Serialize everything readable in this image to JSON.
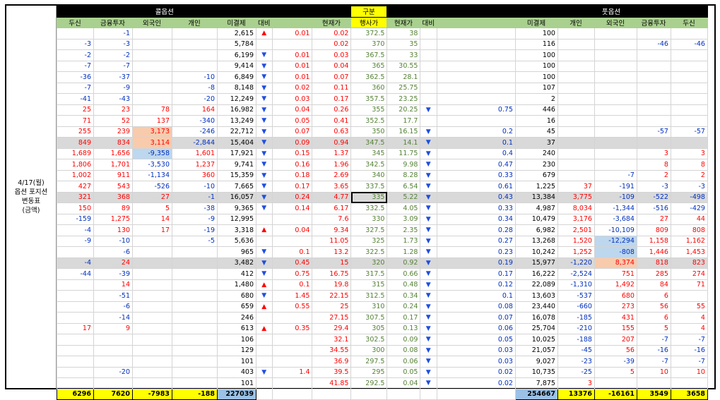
{
  "row_label": [
    "4/17(월)",
    "옵션 포지션",
    "변동표",
    "(금액)"
  ],
  "top": {
    "call": "콜옵션",
    "center": "구분",
    "put": "풋옵션"
  },
  "headers": [
    "두신",
    "금융투자",
    "외국인",
    "개인",
    "미결제",
    "대비",
    "",
    "현재가",
    "행사가",
    "현재가",
    "대비",
    "",
    "미결제",
    "개인",
    "외국인",
    "금융투자",
    "두신"
  ],
  "colors": {
    "header_green": "#a9d08e",
    "total_yellow": "#ffff00",
    "highlight_orange": "#f8cbad",
    "highlight_blue": "#bdd7ee",
    "row_gray": "#d9d9d9"
  },
  "rows": [
    {
      "c": [
        "",
        "-1",
        "",
        "",
        "2,615",
        "▲",
        "0.01",
        "0.02",
        "372.5",
        "38",
        "",
        "",
        "100",
        "",
        "",
        "",
        ""
      ]
    },
    {
      "c": [
        "-3",
        "-3",
        "",
        "",
        "5,784",
        "",
        "",
        "0.02",
        "370",
        "35",
        "",
        "",
        "116",
        "",
        "",
        "-46",
        "-46"
      ]
    },
    {
      "c": [
        "-2",
        "-2",
        "",
        "",
        "6,199",
        "▼",
        "0.01",
        "0.03",
        "367.5",
        "33",
        "",
        "",
        "100",
        "",
        "",
        "",
        ""
      ]
    },
    {
      "c": [
        "-7",
        "-7",
        "",
        "",
        "9,414",
        "▼",
        "0.01",
        "0.04",
        "365",
        "30.55",
        "",
        "",
        "100",
        "",
        "",
        "",
        ""
      ]
    },
    {
      "c": [
        "-36",
        "-37",
        "",
        "-10",
        "6,849",
        "▼",
        "0.01",
        "0.07",
        "362.5",
        "28.1",
        "",
        "",
        "100",
        "",
        "",
        "",
        ""
      ]
    },
    {
      "c": [
        "-7",
        "-9",
        "",
        "-8",
        "8,148",
        "▼",
        "0.02",
        "0.11",
        "360",
        "25.75",
        "",
        "",
        "107",
        "",
        "",
        "",
        ""
      ]
    },
    {
      "c": [
        "-41",
        "-43",
        "",
        "-20",
        "12,249",
        "▼",
        "0.03",
        "0.17",
        "357.5",
        "23.25",
        "",
        "",
        "2",
        "",
        "",
        "",
        ""
      ]
    },
    {
      "c": [
        "25",
        "23",
        "78",
        "164",
        "16,982",
        "▼",
        "0.04",
        "0.26",
        "355",
        "20.25",
        "▼",
        "0.75",
        "446",
        "",
        "",
        "",
        ""
      ]
    },
    {
      "c": [
        "71",
        "52",
        "137",
        "-340",
        "13,249",
        "▼",
        "0.05",
        "0.41",
        "352.5",
        "17.7",
        "",
        "",
        "16",
        "",
        "",
        "",
        ""
      ]
    },
    {
      "c": [
        "255",
        "239",
        "3,173",
        "-246",
        "22,712",
        "▼",
        "0.07",
        "0.63",
        "350",
        "16.15",
        "▼",
        "0.2",
        "45",
        "",
        "",
        "-57",
        "-57"
      ]
    },
    {
      "c": [
        "849",
        "834",
        "3,114",
        "-2,844",
        "15,404",
        "▼",
        "0.09",
        "0.94",
        "347.5",
        "14.1",
        "▼",
        "0.1",
        "37",
        "",
        "",
        "",
        ""
      ]
    },
    {
      "c": [
        "1,689",
        "1,656",
        "-9,358",
        "1,601",
        "17,921",
        "▼",
        "0.15",
        "1.37",
        "345",
        "11.75",
        "▼",
        "0.4",
        "240",
        "",
        "",
        "3",
        "3"
      ]
    },
    {
      "c": [
        "1,806",
        "1,701",
        "-3,530",
        "1,237",
        "9,741",
        "▼",
        "0.16",
        "1.96",
        "342.5",
        "9.98",
        "▼",
        "0.47",
        "230",
        "",
        "",
        "8",
        "8"
      ]
    },
    {
      "c": [
        "1,002",
        "911",
        "-1,134",
        "360",
        "15,359",
        "▼",
        "0.18",
        "2.69",
        "340",
        "8.28",
        "▼",
        "0.33",
        "679",
        "",
        "-7",
        "2",
        "2"
      ]
    },
    {
      "c": [
        "427",
        "543",
        "-526",
        "-10",
        "7,665",
        "▼",
        "0.17",
        "3.65",
        "337.5",
        "6.54",
        "▼",
        "0.61",
        "1,225",
        "37",
        "-191",
        "-3",
        "-3"
      ]
    },
    {
      "c": [
        "321",
        "368",
        "27",
        "-1",
        "16,057",
        "▼",
        "0.24",
        "4.77",
        "335",
        "5.22",
        "▼",
        "0.43",
        "13,384",
        "3,775",
        "-109",
        "-522",
        "-498"
      ]
    },
    {
      "c": [
        "150",
        "89",
        "5",
        "-38",
        "9,365",
        "▼",
        "0.14",
        "6.17",
        "332.5",
        "4.05",
        "▼",
        "0.33",
        "4,987",
        "8,034",
        "-1,344",
        "-516",
        "-429"
      ]
    },
    {
      "c": [
        "-159",
        "1,275",
        "14",
        "-9",
        "12,995",
        "",
        "",
        "7.6",
        "330",
        "3.09",
        "▼",
        "0.34",
        "10,479",
        "3,176",
        "-3,684",
        "27",
        "44"
      ]
    },
    {
      "c": [
        "-4",
        "130",
        "17",
        "-19",
        "3,318",
        "▲",
        "0.04",
        "9.34",
        "327.5",
        "2.35",
        "▼",
        "0.28",
        "6,982",
        "2,501",
        "-10,109",
        "809",
        "808"
      ]
    },
    {
      "c": [
        "-9",
        "-10",
        "",
        "-5",
        "5,636",
        "",
        "",
        "11.05",
        "325",
        "1.73",
        "▼",
        "0.27",
        "13,268",
        "1,520",
        "-12,294",
        "1,158",
        "1,162"
      ]
    },
    {
      "c": [
        "",
        "-6",
        "",
        "",
        "965",
        "▼",
        "0.1",
        "13.2",
        "322.5",
        "1.28",
        "▼",
        "0.23",
        "10,242",
        "1,252",
        "-808",
        "1,446",
        "1,453"
      ]
    },
    {
      "c": [
        "-4",
        "24",
        "",
        "",
        "3,482",
        "▼",
        "0.45",
        "15",
        "320",
        "0.92",
        "▼",
        "0.19",
        "15,977",
        "-1,220",
        "8,374",
        "818",
        "823"
      ]
    },
    {
      "c": [
        "-44",
        "-39",
        "",
        "",
        "412",
        "▼",
        "0.75",
        "16.75",
        "317.5",
        "0.66",
        "▼",
        "0.17",
        "16,222",
        "-2,524",
        "751",
        "285",
        "274"
      ]
    },
    {
      "c": [
        "",
        "14",
        "",
        "",
        "1,480",
        "▲",
        "0.1",
        "19.8",
        "315",
        "0.48",
        "▼",
        "0.12",
        "22,089",
        "-1,310",
        "1,492",
        "84",
        "71"
      ]
    },
    {
      "c": [
        "",
        "-51",
        "",
        "",
        "680",
        "▼",
        "1.45",
        "22.15",
        "312.5",
        "0.34",
        "▼",
        "0.1",
        "13,603",
        "-537",
        "680",
        "6",
        ""
      ]
    },
    {
      "c": [
        "",
        "-6",
        "",
        "",
        "659",
        "▲",
        "0.55",
        "25",
        "310",
        "0.24",
        "▼",
        "0.08",
        "23,440",
        "-660",
        "273",
        "56",
        "55"
      ]
    },
    {
      "c": [
        "",
        "-14",
        "",
        "",
        "246",
        "",
        "",
        "27.15",
        "307.5",
        "0.17",
        "▼",
        "0.07",
        "16,078",
        "-185",
        "431",
        "6",
        "4"
      ]
    },
    {
      "c": [
        "17",
        "9",
        "",
        "",
        "613",
        "▲",
        "0.35",
        "29.4",
        "305",
        "0.13",
        "▼",
        "0.06",
        "25,704",
        "-210",
        "155",
        "5",
        "4"
      ]
    },
    {
      "c": [
        "",
        "",
        "",
        "",
        "106",
        "",
        "",
        "32.1",
        "302.5",
        "0.09",
        "▼",
        "0.05",
        "10,025",
        "-188",
        "207",
        "-7",
        "-7"
      ]
    },
    {
      "c": [
        "",
        "",
        "",
        "",
        "129",
        "",
        "",
        "34.55",
        "300",
        "0.08",
        "▼",
        "0.03",
        "21,057",
        "-45",
        "56",
        "-16",
        "-16"
      ]
    },
    {
      "c": [
        "",
        "",
        "",
        "",
        "101",
        "",
        "",
        "36.9",
        "297.5",
        "0.06",
        "▼",
        "0.03",
        "9,027",
        "-23",
        "-39",
        "-7",
        "-7"
      ]
    },
    {
      "c": [
        "",
        "-20",
        "",
        "",
        "403",
        "▼",
        "1.4",
        "39.5",
        "295",
        "0.05",
        "▼",
        "0.02",
        "10,735",
        "-25",
        "5",
        "10",
        "10"
      ]
    },
    {
      "c": [
        "",
        "",
        "",
        "",
        "101",
        "",
        "",
        "41.85",
        "292.5",
        "0.04",
        "▼",
        "0.02",
        "7,875",
        "3",
        "",
        "",
        ""
      ]
    }
  ],
  "totals": [
    "6296",
    "7620",
    "-7983",
    "-188",
    "227039",
    "",
    "",
    "",
    "",
    "",
    "",
    "",
    "254667",
    "13376",
    "-16161",
    "3549",
    "3658"
  ]
}
